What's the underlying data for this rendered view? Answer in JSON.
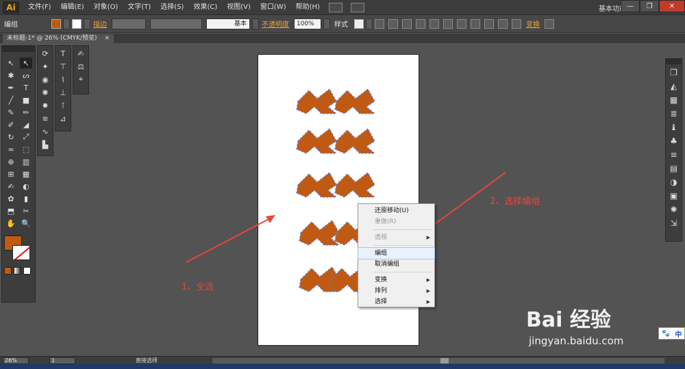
{
  "menubar": {
    "app_logo": "Ai",
    "items": [
      "文件(F)",
      "编辑(E)",
      "对象(O)",
      "文字(T)",
      "选择(S)",
      "效果(C)",
      "视图(V)",
      "窗口(W)",
      "帮助(H)"
    ],
    "workspace": "基本功能",
    "window_buttons": [
      "—",
      "❐",
      "✕"
    ]
  },
  "controlbar": {
    "selection_label": "编组",
    "stroke_label": "描边",
    "stroke_style": "基本",
    "opacity_label": "不透明度",
    "opacity_value": "100%",
    "style_label": "样式",
    "transform_label": "变换",
    "fill_color": "#c05a12"
  },
  "doctab": {
    "title": "未标题-1* @ 26% (CMYK/预览)",
    "close": "×"
  },
  "tools": {
    "main": [
      "selection-icon",
      "direct-selection-icon",
      "magic-wand-icon",
      "lasso-icon",
      "pen-icon",
      "type-icon",
      "line-icon",
      "rectangle-icon",
      "paintbrush-icon",
      "pencil-icon",
      "blob-brush-icon",
      "eraser-icon",
      "rotate-icon",
      "scale-icon",
      "width-icon",
      "free-transform-icon",
      "shape-builder-icon",
      "perspective-grid-icon",
      "mesh-icon",
      "gradient-icon",
      "eyedropper-icon",
      "blend-icon",
      "symbol-sprayer-icon",
      "column-graph-icon",
      "artboard-icon",
      "slice-icon",
      "hand-icon",
      "zoom-icon"
    ],
    "glyphs": [
      "↖",
      "↖",
      "✱",
      "ᔕ",
      "✒",
      "T",
      "╱",
      "■",
      "✎",
      "✏",
      "✐",
      "◢",
      "↻",
      "⤢",
      "≈",
      "⬚",
      "⊕",
      "▥",
      "⊞",
      "▦",
      "✍",
      "◐",
      "✿",
      "▮",
      "⬒",
      "✂",
      "✋",
      "🔍"
    ]
  },
  "color": {
    "fill": "#c05a12",
    "stroke": "#ffffff",
    "slash": "#e01010"
  },
  "context_menu": {
    "items": [
      {
        "label": "还原移动(U)",
        "state": "normal"
      },
      {
        "label": "重做(R)",
        "state": "disabled"
      },
      {
        "label": "透视",
        "state": "disabled",
        "submenu": true
      },
      {
        "label": "编组",
        "state": "highlighted"
      },
      {
        "label": "取消编组",
        "state": "normal"
      },
      {
        "label": "变换",
        "state": "normal",
        "submenu": true
      },
      {
        "label": "排列",
        "state": "normal",
        "submenu": true
      },
      {
        "label": "选择",
        "state": "normal",
        "submenu": true
      }
    ]
  },
  "annotations": {
    "step1": "1、全选",
    "step2": "2、选择编组",
    "color": "#e8463a"
  },
  "watermark": {
    "brand": "Bai  经验",
    "url": "jingyan.baidu.com"
  },
  "ime": {
    "paw": "🐾",
    "lang": "中"
  },
  "statusbar": {
    "zoom": "26%",
    "page": "1",
    "tool": "直接选择"
  }
}
